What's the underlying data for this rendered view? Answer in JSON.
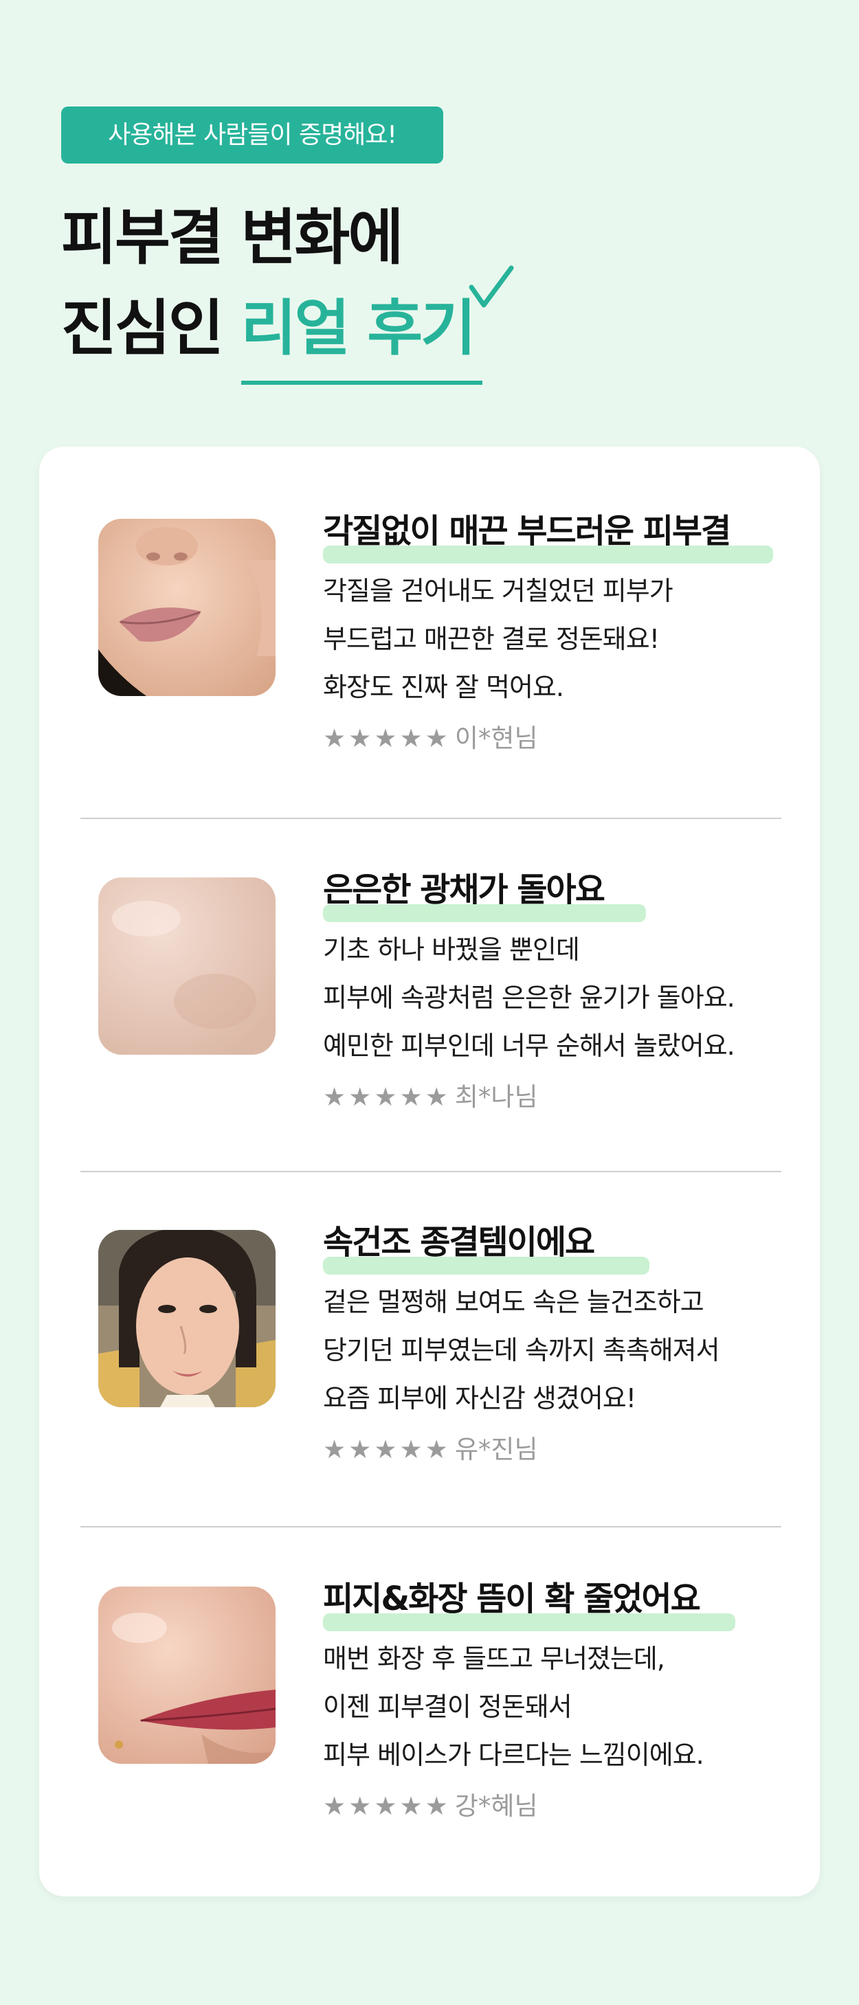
{
  "badge": "사용해본 사람들이 증명해요!",
  "headline": {
    "line1": "피부결 변화에",
    "line2_prefix": "진심인",
    "line2_accent": "리얼 후기"
  },
  "colors": {
    "accent": "#27b39a",
    "background": "#e9f8ee",
    "highlight": "#c9f1d2",
    "star": "#9b9b9b"
  },
  "reviews": [
    {
      "title": "각질없이 매끈 부드러운 피부결",
      "lines": [
        "각질을 걷어내도 거칠었던 피부가",
        "부드럽고 매끈한 결로 정돈돼요!",
        "화장도 진짜 잘 먹어요."
      ],
      "stars": "★★★★★",
      "rating": 5,
      "author": "이*현님"
    },
    {
      "title": "은은한 광채가 돌아요",
      "lines": [
        "기초 하나 바꿨을 뿐인데",
        "피부에 속광처럼 은은한 윤기가 돌아요.",
        "예민한 피부인데 너무 순해서 놀랐어요."
      ],
      "stars": "★★★★★",
      "rating": 5,
      "author": "최*나님"
    },
    {
      "title": "속건조 종결템이에요",
      "lines": [
        "겉은 멀쩡해 보여도 속은 늘건조하고",
        "당기던 피부였는데 속까지 촉촉해져서",
        "요즘 피부에 자신감 생겼어요!"
      ],
      "stars": "★★★★★",
      "rating": 5,
      "author": "유*진님"
    },
    {
      "title": "피지&화장 뜸이 확 줄었어요",
      "lines": [
        "매번 화장 후 들뜨고 무너졌는데,",
        "이젠 피부결이 정돈돼서",
        "피부 베이스가 다르다는 느낌이에요."
      ],
      "stars": "★★★★★",
      "rating": 5,
      "author": "강*혜님"
    }
  ]
}
